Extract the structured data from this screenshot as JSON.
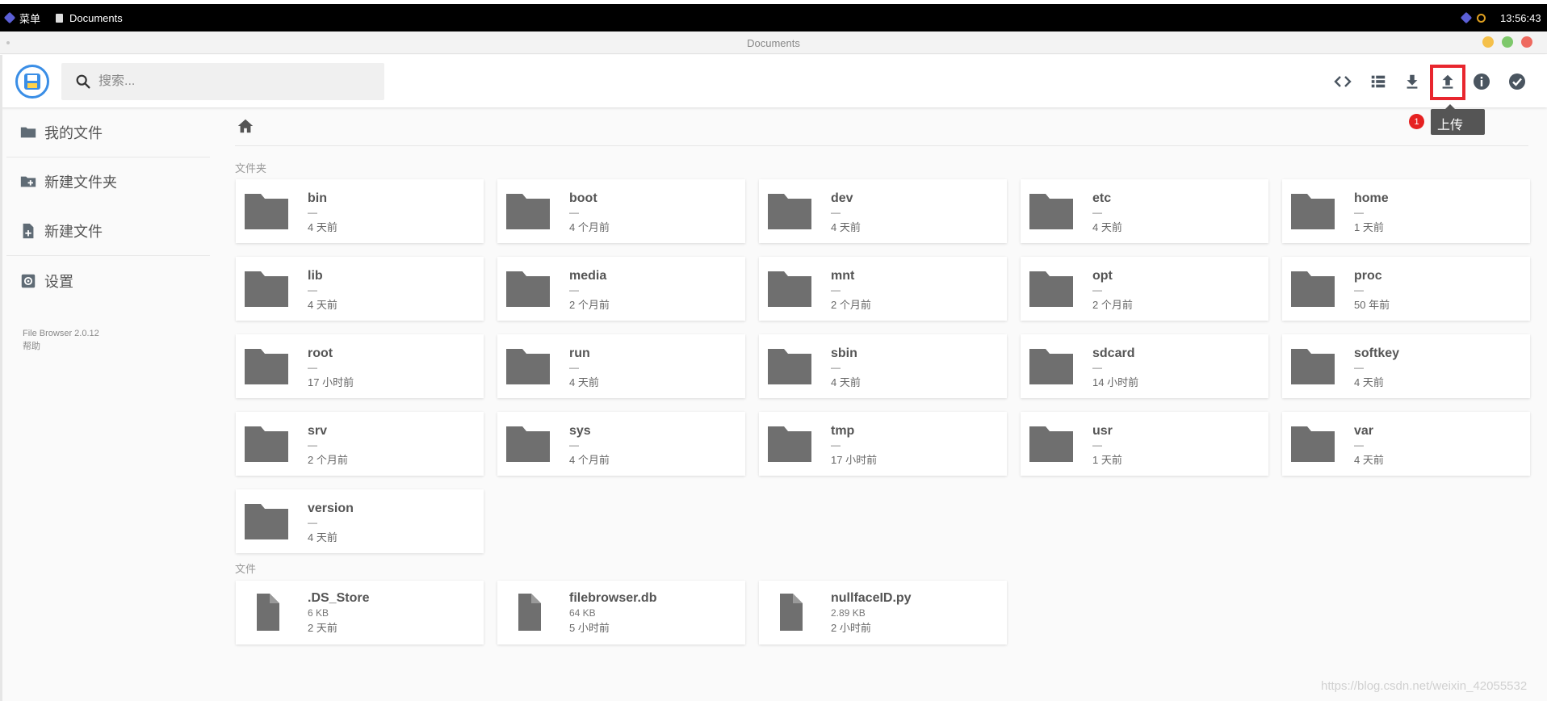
{
  "taskbar": {
    "menu_label": "菜单",
    "app_label": "Documents",
    "clock": "13:56:43"
  },
  "window": {
    "title": "Documents"
  },
  "header": {
    "search_placeholder": "搜索...",
    "actions": [
      "code-icon",
      "view-list-icon",
      "download-icon",
      "upload-icon",
      "info-icon",
      "check-circle-icon"
    ],
    "tooltip": "上传",
    "badge": "1"
  },
  "sidebar": {
    "items": [
      {
        "label": "我的文件",
        "icon": "folder-icon"
      },
      {
        "label": "新建文件夹",
        "icon": "create-folder-icon"
      },
      {
        "label": "新建文件",
        "icon": "note-add-icon"
      },
      {
        "label": "设置",
        "icon": "settings-icon"
      }
    ],
    "version": "File Browser 2.0.12",
    "help": "帮助"
  },
  "listing": {
    "folders_label": "文件夹",
    "files_label": "文件",
    "folders": [
      {
        "name": "bin",
        "size": "—",
        "modified": "4 天前"
      },
      {
        "name": "boot",
        "size": "—",
        "modified": "4 个月前"
      },
      {
        "name": "dev",
        "size": "—",
        "modified": "4 天前"
      },
      {
        "name": "etc",
        "size": "—",
        "modified": "4 天前"
      },
      {
        "name": "home",
        "size": "—",
        "modified": "1 天前"
      },
      {
        "name": "lib",
        "size": "—",
        "modified": "4 天前"
      },
      {
        "name": "media",
        "size": "—",
        "modified": "2 个月前"
      },
      {
        "name": "mnt",
        "size": "—",
        "modified": "2 个月前"
      },
      {
        "name": "opt",
        "size": "—",
        "modified": "2 个月前"
      },
      {
        "name": "proc",
        "size": "—",
        "modified": "50 年前"
      },
      {
        "name": "root",
        "size": "—",
        "modified": "17 小时前"
      },
      {
        "name": "run",
        "size": "—",
        "modified": "4 天前"
      },
      {
        "name": "sbin",
        "size": "—",
        "modified": "4 天前"
      },
      {
        "name": "sdcard",
        "size": "—",
        "modified": "14 小时前"
      },
      {
        "name": "softkey",
        "size": "—",
        "modified": "4 天前"
      },
      {
        "name": "srv",
        "size": "—",
        "modified": "2 个月前"
      },
      {
        "name": "sys",
        "size": "—",
        "modified": "4 个月前"
      },
      {
        "name": "tmp",
        "size": "—",
        "modified": "17 小时前"
      },
      {
        "name": "usr",
        "size": "—",
        "modified": "1 天前"
      },
      {
        "name": "var",
        "size": "—",
        "modified": "4 天前"
      },
      {
        "name": "version",
        "size": "—",
        "modified": "4 天前"
      }
    ],
    "files": [
      {
        "name": ".DS_Store",
        "size": "6 KB",
        "modified": "2 天前"
      },
      {
        "name": "filebrowser.db",
        "size": "64 KB",
        "modified": "5 小时前"
      },
      {
        "name": "nullfaceID.py",
        "size": "2.89 KB",
        "modified": "2 小时前"
      }
    ]
  },
  "watermark": "https://blog.csdn.net/weixin_42055532",
  "colors": {
    "accent": "#3a8ee6",
    "highlight": "#e8262e",
    "icon": "#6f6f6f",
    "badge": "#e62121"
  }
}
